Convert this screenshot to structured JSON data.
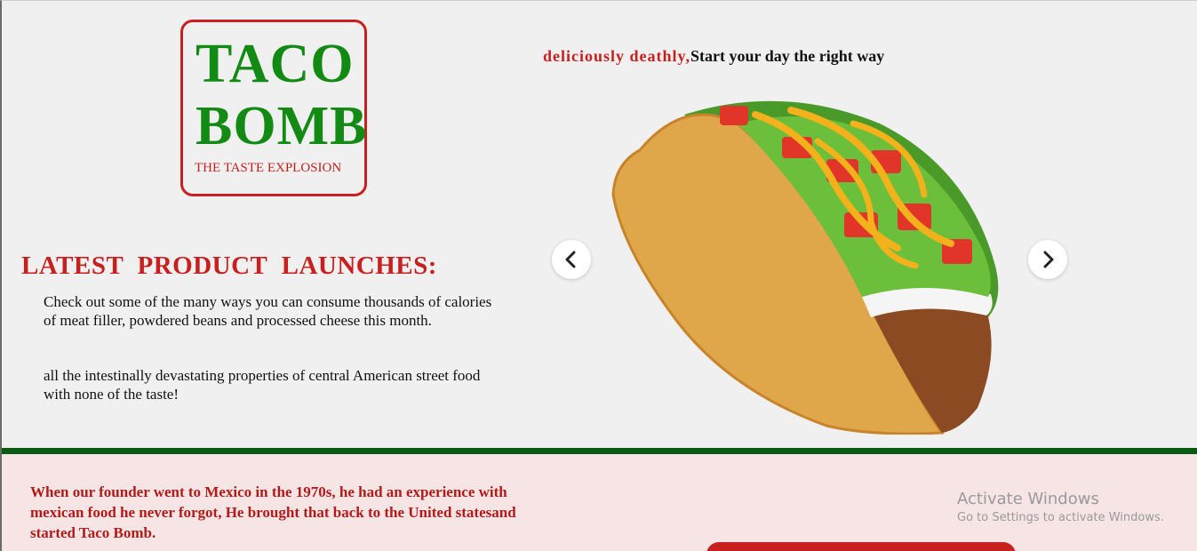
{
  "logo": {
    "line1": "TACO",
    "line2": "BOMB",
    "tagline": "THE TASTE EXPLOSION"
  },
  "slogan": {
    "highlight": "deliciously deathly,",
    "rest": "Start your day the right way"
  },
  "launches": {
    "title": "LATEST  PRODUCT  LAUNCHES:",
    "paragraph1": "Check out some of the many ways you can consume thousands of calories of meat filler, powdered beans and processed cheese this month.",
    "paragraph2": "all the intestinally devastating properties of central American street food with none of the taste!"
  },
  "carousel": {
    "image": "taco-image",
    "prev_icon": "chevron-left-icon",
    "next_icon": "chevron-right-icon"
  },
  "about": {
    "text": "When our founder went to Mexico in the 1970s, he had an experience with mexican food he never forgot, He brought that back to the United statesand started Taco Bomb."
  },
  "watermark": {
    "title": "Activate Windows",
    "subtitle": "Go to Settings to activate Windows."
  },
  "colors": {
    "brand_red": "#c8201f",
    "brand_green": "#138a13",
    "divider_green": "#0b5a13",
    "bottom_bg": "#f7e4e5"
  }
}
